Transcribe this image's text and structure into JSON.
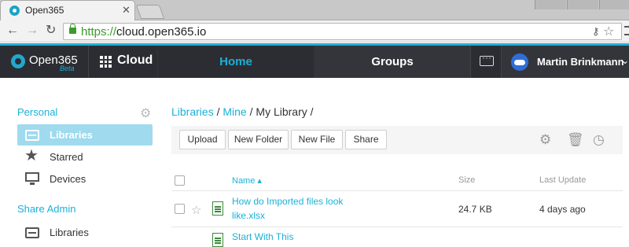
{
  "browser": {
    "tab_title": "Open365",
    "tab_close": "✕",
    "url_scheme": "https://",
    "url_host": "cloud.open365.io",
    "icons": [
      "back-icon",
      "forward-icon",
      "reload-icon",
      "lock-icon",
      "key-icon",
      "bookmark-star-icon",
      "chrome-menu-icon"
    ]
  },
  "header": {
    "logo_text": "Open365",
    "logo_badge": "Beta",
    "cloud_label": "Cloud",
    "nav": {
      "home": "Home",
      "groups": "Groups"
    },
    "user_name": "Martin Brinkmann",
    "accent": "#1ab1d8",
    "bar_color": "#34353b"
  },
  "sidebar": {
    "personal_heading": "Personal",
    "personal_items": [
      {
        "label": "Libraries",
        "icon": "library-icon",
        "active": true
      },
      {
        "label": "Starred",
        "icon": "star-icon",
        "active": false
      },
      {
        "label": "Devices",
        "icon": "monitor-icon",
        "active": false
      }
    ],
    "share_admin_heading": "Share Admin",
    "share_admin_items": [
      {
        "label": "Libraries",
        "icon": "library-icon",
        "active": false
      }
    ]
  },
  "main": {
    "breadcrumb": {
      "libraries": "Libraries",
      "mine": "Mine",
      "current": "My Library",
      "sep": "/"
    },
    "toolbar": {
      "upload": "Upload",
      "new_folder": "New Folder",
      "new_file": "New File",
      "share": "Share",
      "icons": [
        "settings-icon",
        "trash-icon",
        "history-icon"
      ]
    },
    "columns": {
      "name": "Name ▴",
      "size": "Size",
      "last_update": "Last Update"
    },
    "rows": [
      {
        "name_line1": "How do Imported files look",
        "name_line2": "like.xlsx",
        "size": "24.7 KB",
        "updated": "4 days ago"
      },
      {
        "name_line1": "Start With This",
        "name_line2": "",
        "size": "",
        "updated": ""
      }
    ]
  }
}
